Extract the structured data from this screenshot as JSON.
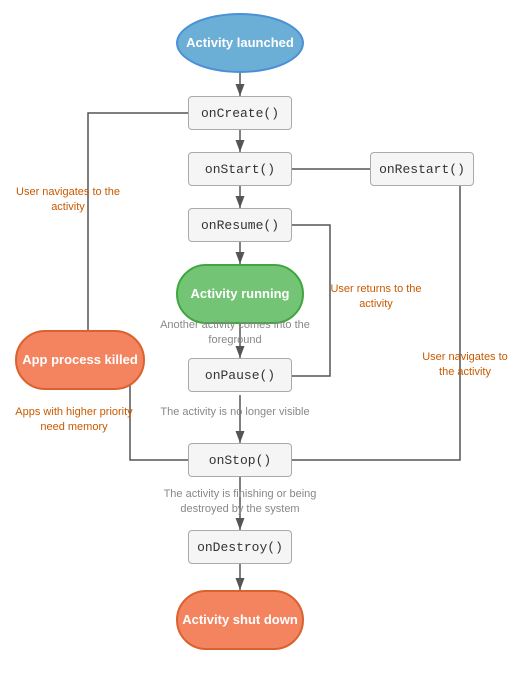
{
  "nodes": {
    "activity_launched": {
      "label": "Activity\nlaunched"
    },
    "on_create": {
      "label": "onCreate()"
    },
    "on_start": {
      "label": "onStart()"
    },
    "on_restart": {
      "label": "onRestart()"
    },
    "on_resume": {
      "label": "onResume()"
    },
    "activity_running": {
      "label": "Activity\nrunning"
    },
    "on_pause": {
      "label": "onPause()"
    },
    "on_stop": {
      "label": "onStop()"
    },
    "on_destroy": {
      "label": "onDestroy()"
    },
    "activity_shutdown": {
      "label": "Activity\nshut down"
    },
    "app_process_killed": {
      "label": "App process\nkilled"
    }
  },
  "annotations": {
    "user_navigates_to": "User navigates\nto the activity",
    "apps_higher_priority": "Apps with higher priority\nneed memory",
    "another_activity": "Another activity comes\ninto the foreground",
    "activity_no_longer": "The activity is\nno longer visible",
    "activity_finishing": "The activity is finishing or\nbeing destroyed by the system",
    "user_returns": "User returns\nto the activity",
    "user_navigates_to2": "User navigates\nto the activity"
  }
}
